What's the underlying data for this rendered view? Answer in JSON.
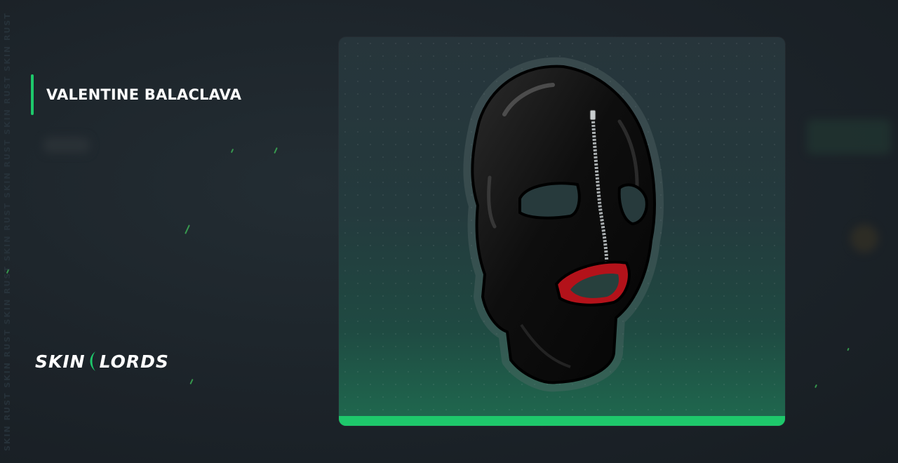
{
  "item": {
    "name": "VALENTINE BALACLAVA"
  },
  "watermark": {
    "text": "SKIN RUST SKIN RUST SKIN RUST SKIN RUST SKIN RUST SKIN RUST SKIN RUST"
  },
  "brand": {
    "logo_left": "SKIN",
    "logo_right": "LORDS",
    "logo_icon": "crescent-mark-icon"
  },
  "image": {
    "subject": "mask-icon"
  },
  "colors": {
    "accent": "#1ec86b",
    "background": "#1c2329",
    "mask_red": "#b3121a"
  }
}
